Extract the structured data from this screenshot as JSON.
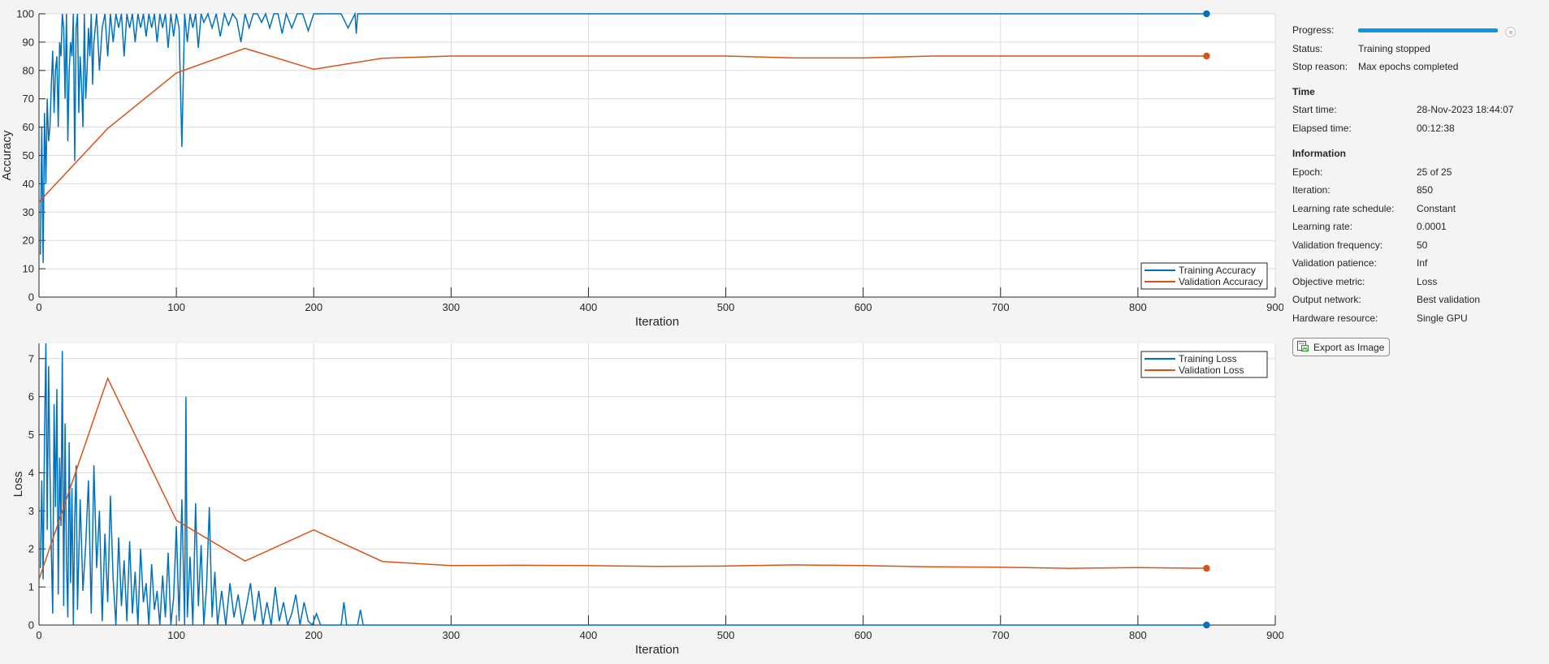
{
  "colors": {
    "training": "#0072BD",
    "validation": "#D95319",
    "progress": "#0f95e8"
  },
  "panel": {
    "progress_label": "Progress:",
    "progress_fraction": 1.0,
    "status_label": "Status:",
    "status_value": "Training stopped",
    "stop_reason_label": "Stop reason:",
    "stop_reason_value": "Max epochs completed",
    "time_heading": "Time",
    "start_time_label": "Start time:",
    "start_time_value": "28-Nov-2023 18:44:07",
    "elapsed_label": "Elapsed time:",
    "elapsed_value": "00:12:38",
    "info_heading": "Information",
    "epoch_label": "Epoch:",
    "epoch_value": "25 of 25",
    "iteration_label": "Iteration:",
    "iteration_value": "850",
    "lr_schedule_label": "Learning rate schedule:",
    "lr_schedule_value": "Constant",
    "lr_label": "Learning rate:",
    "lr_value": "0.0001",
    "val_freq_label": "Validation frequency:",
    "val_freq_value": "50",
    "val_patience_label": "Validation patience:",
    "val_patience_value": "Inf",
    "objective_label": "Objective metric:",
    "objective_value": "Loss",
    "output_net_label": "Output network:",
    "output_net_value": "Best validation",
    "hardware_label": "Hardware resource:",
    "hardware_value": "Single GPU",
    "export_label": "Export as Image",
    "export_icon": "image-export-icon"
  },
  "chart_data": [
    {
      "type": "line",
      "xlabel": "Iteration",
      "ylabel": "Accuracy",
      "xlim": [
        0,
        900
      ],
      "ylim": [
        0,
        100
      ],
      "xticks": [
        0,
        100,
        200,
        300,
        400,
        500,
        600,
        700,
        800,
        900
      ],
      "yticks": [
        0,
        10,
        20,
        30,
        40,
        50,
        60,
        70,
        80,
        90,
        100
      ],
      "grid": true,
      "legend_position": "bottom-right",
      "series": [
        {
          "name": "Training Accuracy",
          "color": "#0072BD",
          "x": [
            1,
            2,
            3,
            4,
            5,
            6,
            7,
            8,
            9,
            10,
            11,
            12,
            13,
            14,
            15,
            16,
            17,
            18,
            19,
            20,
            21,
            22,
            23,
            24,
            25,
            26,
            27,
            28,
            29,
            30,
            31,
            32,
            33,
            34,
            35,
            36,
            37,
            38,
            39,
            40,
            42,
            44,
            46,
            48,
            50,
            52,
            54,
            56,
            58,
            60,
            62,
            64,
            66,
            68,
            70,
            72,
            74,
            76,
            78,
            80,
            82,
            84,
            86,
            88,
            90,
            92,
            94,
            96,
            98,
            100,
            102,
            104,
            106,
            108,
            110,
            112,
            114,
            116,
            118,
            120,
            123,
            126,
            129,
            132,
            135,
            138,
            141,
            144,
            147,
            150,
            153,
            156,
            159,
            162,
            165,
            168,
            171,
            174,
            177,
            180,
            184,
            188,
            192,
            196,
            200,
            210,
            220,
            225,
            230,
            231,
            232,
            240,
            300,
            400,
            500,
            600,
            700,
            800,
            850
          ],
          "y": [
            15,
            60,
            12,
            65,
            40,
            70,
            55,
            60,
            75,
            87,
            65,
            80,
            85,
            60,
            90,
            85,
            100,
            95,
            70,
            100,
            55,
            80,
            90,
            85,
            100,
            48,
            95,
            100,
            65,
            85,
            75,
            60,
            100,
            70,
            80,
            95,
            85,
            100,
            75,
            90,
            100,
            80,
            95,
            100,
            85,
            100,
            90,
            100,
            95,
            100,
            85,
            100,
            95,
            100,
            90,
            100,
            95,
            100,
            92,
            100,
            95,
            100,
            90,
            100,
            95,
            100,
            88,
            100,
            92,
            100,
            95,
            53,
            100,
            90,
            100,
            95,
            100,
            88,
            100,
            97,
            100,
            95,
            100,
            92,
            100,
            96,
            100,
            98,
            90,
            100,
            95,
            100,
            100,
            97,
            100,
            95,
            100,
            100,
            93,
            100,
            95,
            100,
            100,
            94,
            100,
            100,
            100,
            95,
            100,
            93,
            100,
            100,
            100,
            100,
            100,
            100,
            100,
            100,
            100
          ]
        },
        {
          "name": "Validation Accuracy",
          "color": "#D95319",
          "x": [
            0,
            50,
            100,
            150,
            200,
            250,
            300,
            350,
            400,
            450,
            500,
            550,
            600,
            650,
            700,
            750,
            800,
            850
          ],
          "y": [
            33.6,
            59.5,
            79.1,
            87.8,
            80.4,
            84.3,
            85.1,
            85.1,
            85.1,
            85.1,
            85.1,
            84.4,
            84.4,
            85.1,
            85.1,
            85.1,
            85.1,
            85.1
          ]
        }
      ]
    },
    {
      "type": "line",
      "xlabel": "Iteration",
      "ylabel": "Loss",
      "xlim": [
        0,
        900
      ],
      "ylim": [
        0,
        7.4
      ],
      "xticks": [
        0,
        100,
        200,
        300,
        400,
        500,
        600,
        700,
        800,
        900
      ],
      "yticks": [
        0,
        1,
        2,
        3,
        4,
        5,
        6,
        7
      ],
      "grid": true,
      "legend_position": "top-right",
      "series": [
        {
          "name": "Training Loss",
          "color": "#0072BD",
          "x": [
            1,
            2,
            3,
            4,
            5,
            6,
            7,
            8,
            9,
            10,
            11,
            12,
            13,
            14,
            15,
            16,
            17,
            18,
            19,
            20,
            21,
            22,
            23,
            24,
            25,
            26,
            27,
            28,
            30,
            32,
            34,
            36,
            38,
            40,
            42,
            44,
            46,
            48,
            50,
            52,
            54,
            56,
            58,
            60,
            62,
            64,
            66,
            68,
            70,
            72,
            74,
            76,
            78,
            80,
            82,
            84,
            86,
            88,
            90,
            92,
            94,
            96,
            98,
            100,
            102,
            104,
            106,
            107,
            108,
            110,
            112,
            114,
            116,
            118,
            120,
            122,
            124,
            126,
            128,
            130,
            133,
            136,
            139,
            142,
            145,
            148,
            151,
            154,
            157,
            160,
            163,
            166,
            169,
            172,
            175,
            178,
            181,
            184,
            187,
            190,
            193,
            196,
            199,
            202,
            205,
            220,
            222,
            224,
            232,
            234,
            236,
            250,
            300,
            400,
            500,
            600,
            700,
            800,
            850
          ],
          "y": [
            1.5,
            3.8,
            1.2,
            5.0,
            7.4,
            2.5,
            6.8,
            4.1,
            1.9,
            0.3,
            5.8,
            3.1,
            6.2,
            0.8,
            4.4,
            2.6,
            7.2,
            0.5,
            5.3,
            1.7,
            0.2,
            4.8,
            1.1,
            3.6,
            0.0,
            2.8,
            4.2,
            0.4,
            3.3,
            0.9,
            2.1,
            3.8,
            0.3,
            4.2,
            1.5,
            3.0,
            0.1,
            2.4,
            0.6,
            3.4,
            1.2,
            0.0,
            2.3,
            0.5,
            1.7,
            0.1,
            2.2,
            0.3,
            1.4,
            0.0,
            2.0,
            0.6,
            1.1,
            0.0,
            1.6,
            0.4,
            0.9,
            0.0,
            1.3,
            0.2,
            1.9,
            0.0,
            0.7,
            2.6,
            0.1,
            3.3,
            0.0,
            6.0,
            0.2,
            1.8,
            0.0,
            3.2,
            0.5,
            2.1,
            0.0,
            1.0,
            3.1,
            0.2,
            1.4,
            0.0,
            0.9,
            0.0,
            1.1,
            0.2,
            0.8,
            0.0,
            0.5,
            1.1,
            0.1,
            0.9,
            0.0,
            0.6,
            0.0,
            1.0,
            0.1,
            0.6,
            0.0,
            0.3,
            0.8,
            0.0,
            0.6,
            0.1,
            0.0,
            0.3,
            0.0,
            0.0,
            0.6,
            0.0,
            0.0,
            0.4,
            0.0,
            0.0,
            0.0,
            0.0,
            0.0,
            0.0,
            0.0,
            0.0,
            0.0
          ]
        },
        {
          "name": "Validation Loss",
          "color": "#D95319",
          "x": [
            0,
            50,
            100,
            150,
            200,
            250,
            300,
            350,
            400,
            450,
            500,
            550,
            600,
            650,
            700,
            750,
            800,
            850
          ],
          "y": [
            1.2,
            6.48,
            2.75,
            1.68,
            2.5,
            1.67,
            1.56,
            1.57,
            1.56,
            1.54,
            1.55,
            1.58,
            1.56,
            1.53,
            1.52,
            1.49,
            1.51,
            1.49
          ]
        }
      ]
    }
  ]
}
